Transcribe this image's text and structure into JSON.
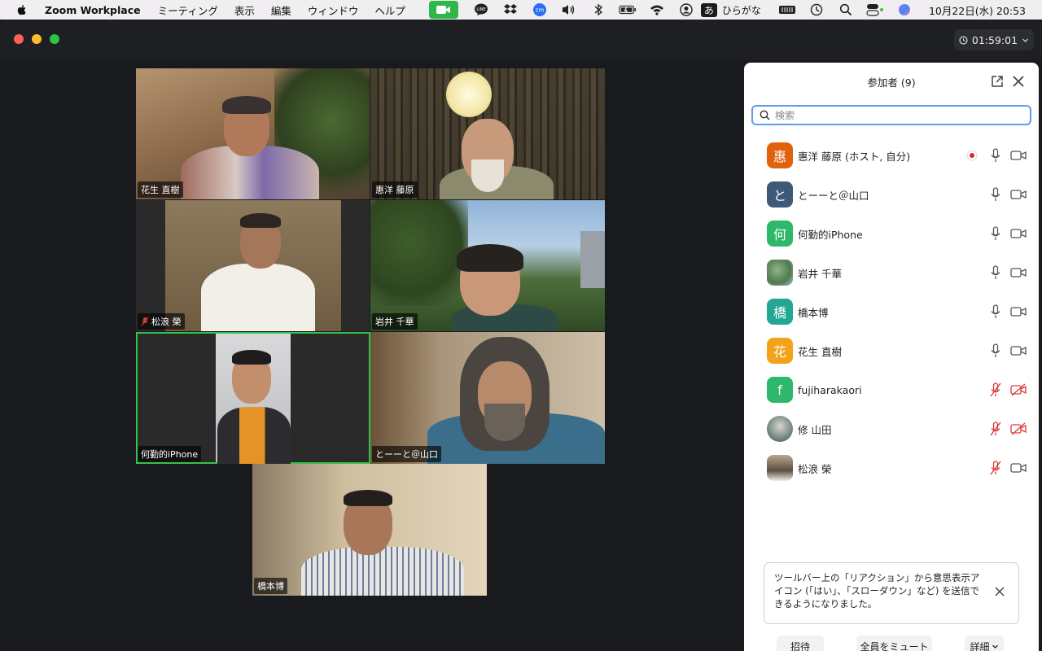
{
  "menubar": {
    "app_name": "Zoom Workplace",
    "menus": [
      "ミーティング",
      "表示",
      "編集",
      "ウィンドウ",
      "ヘルプ"
    ],
    "ime_box": "あ",
    "ime_label": "ひらがな",
    "clock": "10月22日(水)  20:53"
  },
  "window": {
    "timer": "01:59:01"
  },
  "tiles": [
    {
      "name": "花生 直樹"
    },
    {
      "name": "惠洋 藤原"
    },
    {
      "name": "松浪 榮"
    },
    {
      "name": "岩井 千華"
    },
    {
      "name": "何勤的iPhone"
    },
    {
      "name": "とーーと＠山口"
    },
    {
      "name": "橋本博"
    }
  ],
  "panel": {
    "title": "参加者 (9)",
    "search_placeholder": "検索",
    "participants": [
      {
        "name": "惠洋 藤原 (ホスト, 自分)",
        "avatar": "惠",
        "color": "#e0620f"
      },
      {
        "name": "とーーと＠山口",
        "avatar": "と",
        "color": "#3d5a78"
      },
      {
        "name": "何勤的iPhone",
        "avatar": "何",
        "color": "#2db86a"
      },
      {
        "name": "岩井 千華",
        "avatar": "",
        "color": "#5a8a52"
      },
      {
        "name": "橋本博",
        "avatar": "橋",
        "color": "#22a795"
      },
      {
        "name": "花生 直樹",
        "avatar": "花",
        "color": "#f2a31a"
      },
      {
        "name": "fujiharakaori",
        "avatar": "f",
        "color": "#2db86a"
      },
      {
        "name": "修 山田",
        "avatar": "",
        "color": "#7f8f8a"
      },
      {
        "name": "松浪 榮",
        "avatar": "",
        "color": "#5c4f44"
      }
    ],
    "toast": "ツールバー上の「リアクション」から意思表示アイコン (「はい」、「スローダウン」など) を送信できるようになりました。",
    "buttons": {
      "invite": "招待",
      "mute_all": "全員をミュート",
      "more": "詳細"
    }
  }
}
